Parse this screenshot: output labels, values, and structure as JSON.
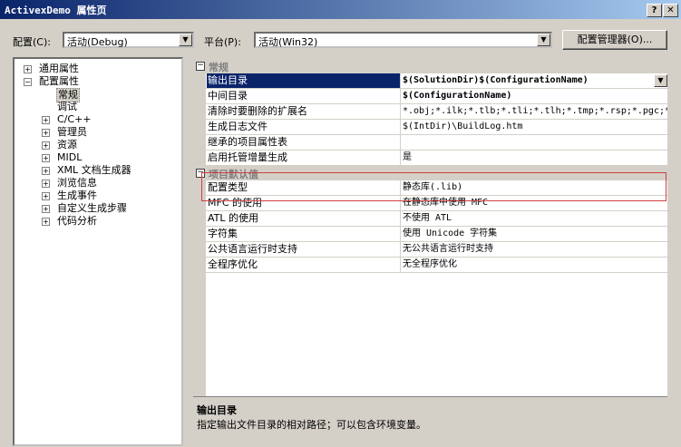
{
  "window": {
    "title": "ActivexDemo 属性页",
    "help_btn": "?",
    "close_btn": "✕"
  },
  "toolbar": {
    "config_label": "配置(C):",
    "config_value": "活动(Debug)",
    "platform_label": "平台(P):",
    "platform_value": "活动(Win32)",
    "config_manager_label": "配置管理器(O)..."
  },
  "tree": {
    "items": [
      {
        "label": "通用属性",
        "toggle": "+"
      },
      {
        "label": "配置属性",
        "toggle": "−"
      },
      {
        "label": "常规",
        "toggle": ""
      },
      {
        "label": "调试",
        "toggle": ""
      },
      {
        "label": "C/C++",
        "toggle": "+"
      },
      {
        "label": "管理员",
        "toggle": "+"
      },
      {
        "label": "资源",
        "toggle": "+"
      },
      {
        "label": "MIDL",
        "toggle": "+"
      },
      {
        "label": "XML 文档生成器",
        "toggle": "+"
      },
      {
        "label": "浏览信息",
        "toggle": "+"
      },
      {
        "label": "生成事件",
        "toggle": "+"
      },
      {
        "label": "自定义生成步骤",
        "toggle": "+"
      },
      {
        "label": "代码分析",
        "toggle": "+"
      }
    ]
  },
  "grid": {
    "categories": [
      {
        "label": "常规",
        "toggle": "−"
      },
      {
        "label": "项目默认值",
        "toggle": "−"
      }
    ],
    "rows_general": [
      {
        "name": "输出目录",
        "value": "$(SolutionDir)$(ConfigurationName)"
      },
      {
        "name": "中间目录",
        "value": "$(ConfigurationName)"
      },
      {
        "name": "清除时要删除的扩展名",
        "value": "*.obj;*.ilk;*.tlb;*.tli;*.tlh;*.tmp;*.rsp;*.pgc;*."
      },
      {
        "name": "生成日志文件",
        "value": "$(IntDir)\\BuildLog.htm"
      },
      {
        "name": "继承的项目属性表",
        "value": ""
      },
      {
        "name": "启用托管增量生成",
        "value": "是"
      }
    ],
    "rows_defaults": [
      {
        "name": "配置类型",
        "value": "静态库(.lib)"
      },
      {
        "name": "MFC 的使用",
        "value": "在静态库中使用 MFC"
      },
      {
        "name": "ATL 的使用",
        "value": "不使用 ATL"
      },
      {
        "name": "字符集",
        "value": "使用 Unicode 字符集"
      },
      {
        "name": "公共语言运行时支持",
        "value": "无公共语言运行时支持"
      },
      {
        "name": "全程序优化",
        "value": "无全程序优化"
      }
    ]
  },
  "description": {
    "title": "输出目录",
    "text": "指定输出文件目录的相对路径；可以包含环境变量。"
  },
  "colors": {
    "highlight": "#d04040",
    "selection": "#0a246a"
  }
}
